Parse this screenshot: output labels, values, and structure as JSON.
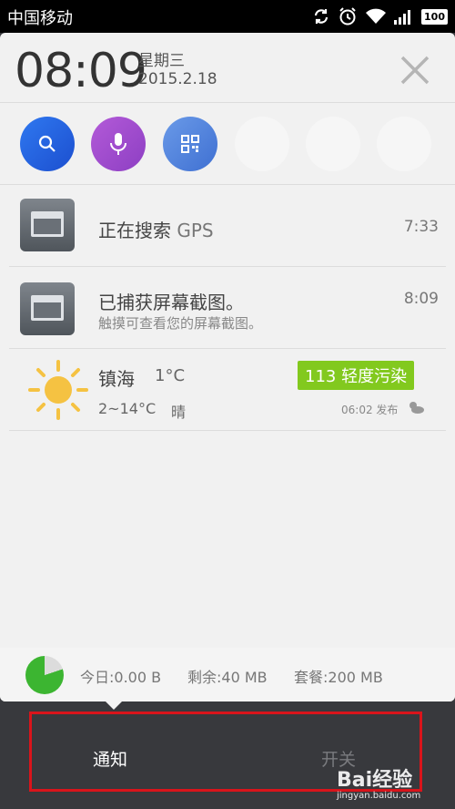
{
  "status_bar": {
    "carrier": "中国移动",
    "battery": "100",
    "icons": [
      "sync-icon",
      "alarm-icon",
      "wifi-icon",
      "signal-icon",
      "battery-icon"
    ]
  },
  "header": {
    "time": "08:09",
    "weekday": "星期三",
    "date": "2015.2.18",
    "close_icon": "close-icon"
  },
  "quick_toggles": [
    {
      "name": "search",
      "icon": "search-icon",
      "color": "#2f78f0"
    },
    {
      "name": "voice",
      "icon": "microphone-icon",
      "color": "#a04ed2"
    },
    {
      "name": "qr-scan",
      "icon": "qr-code-icon",
      "color": "#5a8ae0"
    }
  ],
  "notifications": [
    {
      "title": "正在搜索",
      "title_suffix": "GPS",
      "time": "7:33"
    },
    {
      "title": "已捕获屏幕截图。",
      "subtitle": "触摸可查看您的屏幕截图。",
      "time": "8:09"
    }
  ],
  "weather": {
    "city": "镇海",
    "temp": "1°C",
    "range": "2~14°C",
    "condition": "晴",
    "aqi": "113 轻度污染",
    "published": "06:02 发布",
    "aqi_color": "#82c91e"
  },
  "data_usage": {
    "today": "今日:0.00 B",
    "remaining": "剩余:40 MB",
    "plan": "套餐:200 MB",
    "used_fraction": 0.8
  },
  "tabs": {
    "notify": "通知",
    "switches": "开关"
  },
  "watermark": {
    "logo": "Bai经验",
    "url": "jingyan.baidu.com"
  }
}
